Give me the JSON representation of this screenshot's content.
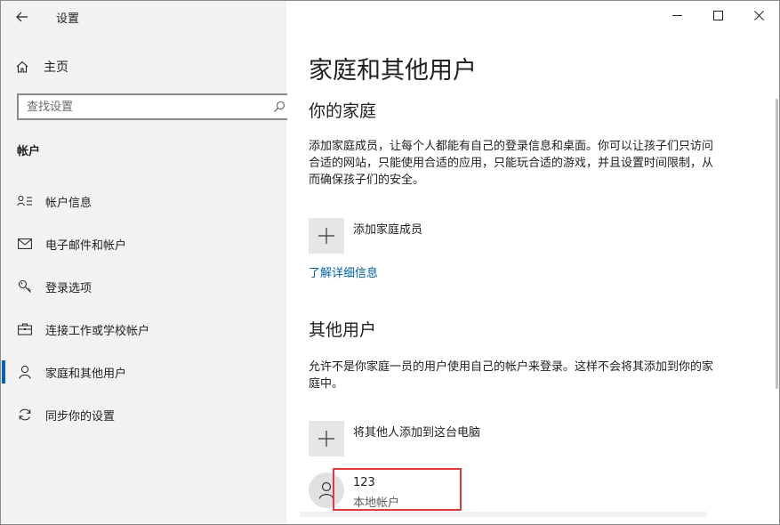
{
  "window": {
    "app_title": "设置",
    "controls": {
      "minimize": "—",
      "maximize": "☐",
      "close": "✕"
    }
  },
  "sidebar": {
    "home_label": "主页",
    "search_placeholder": "查找设置",
    "section_title": "帐户",
    "items": [
      {
        "label": "帐户信息",
        "icon": "account-info-icon"
      },
      {
        "label": "电子邮件和帐户",
        "icon": "mail-icon"
      },
      {
        "label": "登录选项",
        "icon": "key-icon"
      },
      {
        "label": "连接工作或学校帐户",
        "icon": "briefcase-icon"
      },
      {
        "label": "家庭和其他用户",
        "icon": "person-icon",
        "active": true
      },
      {
        "label": "同步你的设置",
        "icon": "sync-icon"
      }
    ]
  },
  "main": {
    "page_title": "家庭和其他用户",
    "family": {
      "heading": "你的家庭",
      "description": "添加家庭成员，让每个人都能有自己的登录信息和桌面。你可以让孩子们只访问合适的网站，只能使用合适的应用，只能玩合适的游戏，并且设置时间限制，从而确保孩子们的安全。",
      "add_label": "添加家庭成员",
      "learn_more": "了解详细信息"
    },
    "others": {
      "heading": "其他用户",
      "description": "允许不是你家庭一员的用户使用自己的帐户来登录。这样不会将其添加到你的家庭中。",
      "add_label": "将其他人添加到这台电脑",
      "user": {
        "name": "123",
        "type": "本地帐户"
      }
    }
  },
  "colors": {
    "accent": "#0063b1",
    "highlight": "#e03a3a",
    "sidebar_bg": "#f2f2f2"
  }
}
